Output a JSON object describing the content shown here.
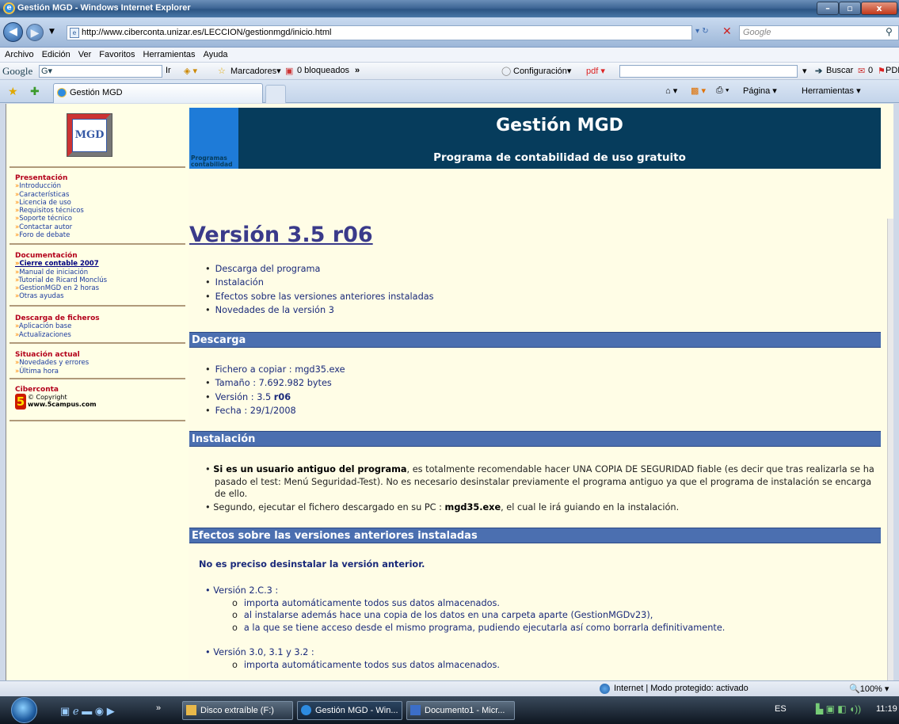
{
  "window": {
    "title": "Gestión MGD - Windows Internet Explorer"
  },
  "address": {
    "url": "http://www.ciberconta.unizar.es/LECCION/gestionmgd/inicio.html",
    "search_placeholder": "Google"
  },
  "menu": [
    "Archivo",
    "Edición",
    "Ver",
    "Favoritos",
    "Herramientas",
    "Ayuda"
  ],
  "gtoolbar": {
    "brand": "Google",
    "g_label": "G▾",
    "ir": "Ir",
    "marcadores": "Marcadores▾",
    "bloqueados": "0 bloqueados",
    "more": "»",
    "config": "Configuración▾",
    "pdf": "pdf ▾",
    "buscar": "Buscar",
    "count": "0",
    "pdf2": "PDF"
  },
  "tabs": {
    "active": "Gestión MGD",
    "pagina": "Página ▾",
    "herramientas": "Herramientas ▾"
  },
  "banner": {
    "title": "Gestión MGD",
    "subtitle": "Programa de contabilidad de uso gratuito",
    "tag": "Programas contabilidad"
  },
  "sidebar": {
    "logo": "MGD",
    "sections": [
      {
        "heading": "Presentación",
        "links": [
          "Introducción",
          "Características",
          "Licencia de uso",
          "Requisitos técnicos",
          "Soporte técnico",
          "Contactar autor",
          "Foro de debate"
        ]
      },
      {
        "heading": "Documentación",
        "links": [
          "Cierre contable 2007",
          "Manual de iniciación",
          "Tutorial de Ricard Monclús",
          "GestionMGD en 2 horas",
          "Otras ayudas"
        ]
      },
      {
        "heading": "Descarga de ficheros",
        "links": [
          "Aplicación base",
          "Actualizaciones"
        ]
      },
      {
        "heading": "Situación actual",
        "links": [
          "Novedades y errores",
          "Última hora"
        ]
      },
      {
        "heading": "Ciberconta",
        "links": []
      }
    ],
    "copyright": "© Copyright",
    "copyright_url": "www.5campus.com"
  },
  "main": {
    "version_title": "Versión 3.5 r06",
    "toc": [
      "Descarga del programa",
      "Instalación",
      "Efectos sobre las versiones anteriores instaladas",
      "Novedades de la versión 3"
    ],
    "descarga_heading": "Descarga",
    "descarga": {
      "file_label": "Fichero a copiar : ",
      "file": "mgd35.exe",
      "size": "Tamaño : 7.692.982 bytes",
      "version_label": "Versión : 3.5 ",
      "version_bold": "r06",
      "date": "Fecha : 29/1/2008"
    },
    "instalacion_heading": "Instalación",
    "inst1_bold": "Si es un usuario antiguo del programa",
    "inst1_rest": ", es totalmente recomendable hacer UNA COPIA DE SEGURIDAD fiable (es decir que tras realizarla se ha pasado el test: Menú Seguridad-Test). No es necesario desinstalar previamente el programa antiguo ya que el programa de instalación se encarga de ello.",
    "inst2_pre": "Segundo, ejecutar el fichero descargado en su PC : ",
    "inst2_bold": "mgd35.exe",
    "inst2_post": ", el cual le irá guiando en la instalación.",
    "efectos_heading": "Efectos sobre las versiones anteriores instaladas",
    "efectos_note": "No es preciso desinstalar la versión anterior.",
    "v1": "Versión 2.C.3 :",
    "v1_items": [
      "importa automáticamente todos sus datos almacenados.",
      "al instalarse además hace una copia de los datos en una carpeta aparte (GestionMGDv23),",
      "a la que se tiene acceso desde el mismo programa, pudiendo ejecutarla así como borrarla definitivamente."
    ],
    "v2": "Versión 3.0, 3.1 y 3.2 :",
    "v2_items": [
      "importa automáticamente todos sus datos almacenados."
    ]
  },
  "status": {
    "zone": "Internet | Modo protegido: activado",
    "zoom": "100%"
  },
  "taskbar": {
    "tasks": [
      "Disco extraíble (F:)",
      "Gestión MGD - Win...",
      "Documento1 - Micr..."
    ],
    "lang": "ES",
    "clock": "11:19"
  }
}
